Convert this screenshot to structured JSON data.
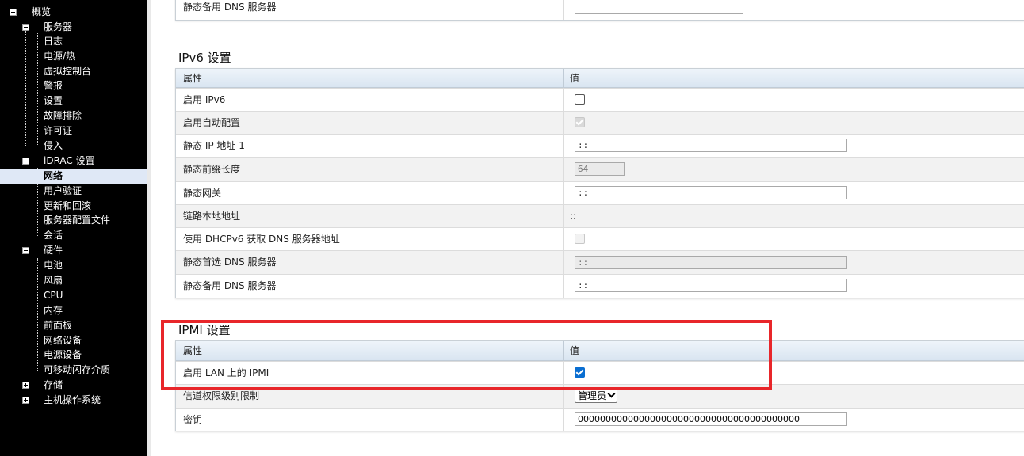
{
  "tree": {
    "items": [
      {
        "label": "概览"
      },
      {
        "label": "服务器"
      },
      {
        "label": "日志"
      },
      {
        "label": "电源/热"
      },
      {
        "label": "虚拟控制台"
      },
      {
        "label": "警报"
      },
      {
        "label": "设置"
      },
      {
        "label": "故障排除"
      },
      {
        "label": "许可证"
      },
      {
        "label": "侵入"
      },
      {
        "label": "iDRAC 设置"
      },
      {
        "label": "网络",
        "selected": true
      },
      {
        "label": "用户验证"
      },
      {
        "label": "更新和回滚"
      },
      {
        "label": "服务器配置文件"
      },
      {
        "label": "会话"
      },
      {
        "label": "硬件"
      },
      {
        "label": "电池"
      },
      {
        "label": "风扇"
      },
      {
        "label": "CPU"
      },
      {
        "label": "内存"
      },
      {
        "label": "前面板"
      },
      {
        "label": "网络设备"
      },
      {
        "label": "电源设备"
      },
      {
        "label": "可移动闪存介质"
      },
      {
        "label": "存储"
      },
      {
        "label": "主机操作系统"
      }
    ]
  },
  "top_partial": {
    "label": "静态备用 DNS 服务器",
    "value": ""
  },
  "ipv6": {
    "title": "IPv6 设置",
    "header": {
      "property": "属性",
      "value": "值"
    },
    "rows": [
      {
        "label": "启用 IPv6",
        "checked": false
      },
      {
        "label": "启用自动配置",
        "checked": true,
        "disabled": true
      },
      {
        "label": "静态 IP 地址 1",
        "value": "::"
      },
      {
        "label": "静态前缀长度",
        "value": "64",
        "disabled": true
      },
      {
        "label": "静态网关",
        "value": "::"
      },
      {
        "label": "链路本地地址",
        "value": "::"
      },
      {
        "label": "使用 DHCPv6 获取 DNS 服务器地址",
        "checked": false,
        "disabled": true
      },
      {
        "label": "静态首选 DNS 服务器",
        "value": "::",
        "disabled": true
      },
      {
        "label": "静态备用 DNS 服务器",
        "value": "::"
      }
    ]
  },
  "ipmi": {
    "title": "IPMI 设置",
    "header": {
      "property": "属性",
      "value": "值"
    },
    "rows": [
      {
        "label": "启用 LAN 上的 IPMI",
        "checked": true
      },
      {
        "label": "信道权限级别限制",
        "selected": "管理员"
      },
      {
        "label": "密钥",
        "value": "0000000000000000000000000000000000000000"
      }
    ]
  },
  "colors": {
    "highlight_box": "#e8262a",
    "checkbox_checked": "#0a6ed1",
    "sidebar_bg": "#000000"
  }
}
